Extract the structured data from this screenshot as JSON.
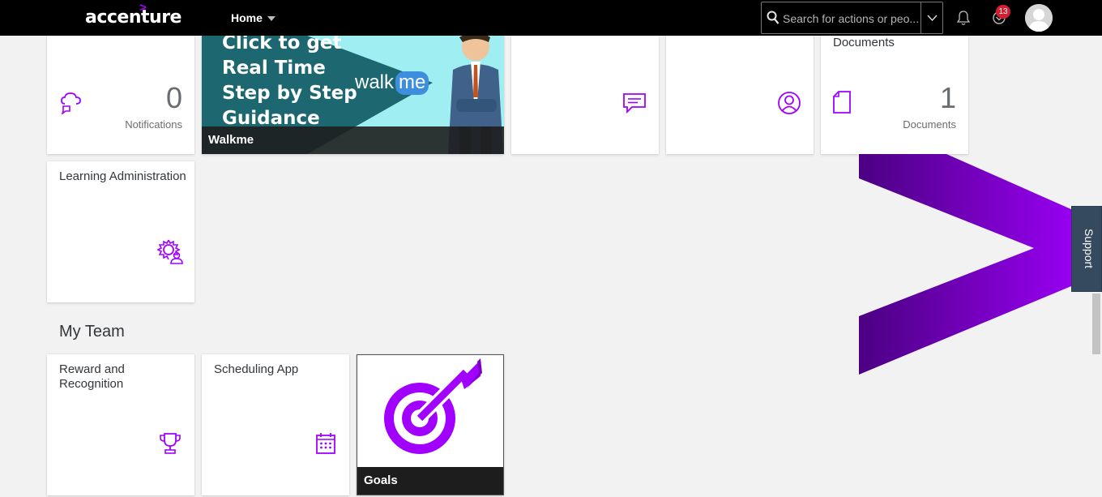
{
  "header": {
    "logo": "accenture",
    "logo_mark": ">",
    "home_label": "Home",
    "search_placeholder": "Search for actions or peo...",
    "notification_count": "13"
  },
  "tiles_top": {
    "notifications": {
      "value": "0",
      "unit": "Notifications"
    },
    "walkme": {
      "banner_lines": [
        "Click to get",
        "Real Time",
        "Step by Step",
        "Guidance"
      ],
      "brand_walk": "walk",
      "brand_me": "me",
      "footer": "Walkme"
    },
    "documents": {
      "title": "Documents",
      "value": "1",
      "unit": "Documents"
    }
  },
  "learning": {
    "title": "Learning Administration"
  },
  "my_team": {
    "heading": "My Team",
    "reward": {
      "title": "Reward and Recognition"
    },
    "scheduling": {
      "title": "Scheduling App"
    },
    "goals": {
      "footer": "Goals"
    }
  },
  "support": {
    "label": "Support"
  },
  "colors": {
    "accent": "#a100ff",
    "shell": "#000000",
    "support_tab": "#354a5f",
    "badge": "#d32030"
  }
}
